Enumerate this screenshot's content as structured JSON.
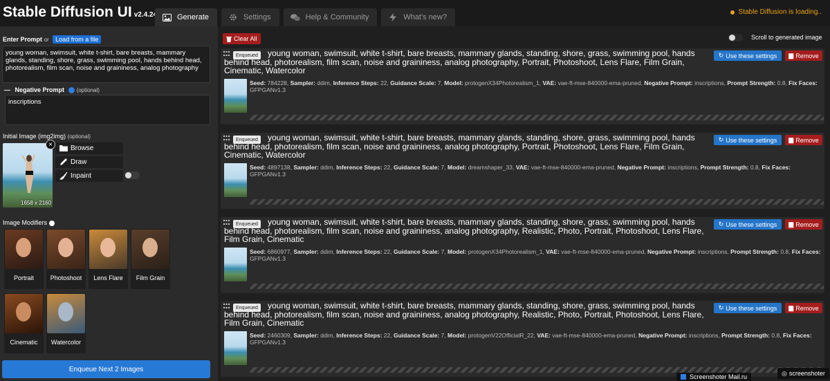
{
  "header": {
    "title": "Stable Diffusion UI",
    "version": "v2.4.24",
    "tabs": [
      {
        "label": "Generate",
        "icon": "image-icon",
        "active": true
      },
      {
        "label": "Settings",
        "icon": "gear-icon",
        "active": false
      },
      {
        "label": "Help & Community",
        "icon": "comments-icon",
        "active": false
      },
      {
        "label": "What's new?",
        "icon": "bolt-icon",
        "active": false
      }
    ],
    "status": "Stable Diffusion is loading..",
    "status_color": "#e8a317"
  },
  "left": {
    "prompt_label": "Enter Prompt",
    "or_text": "or",
    "load_button": "Load from a file",
    "prompt_value": "young woman, swimsuit, white t-shirt, bare breasts, mammary glands, standing, shore, grass, swimming pool, hands behind head, photorealism, film scan, noise and graininess, analog photography",
    "negative_toggle": "—",
    "negative_label": "Negative Prompt",
    "negative_optional": "(optional)",
    "negative_value": "inscriptions",
    "init_label": "Initial Image (img2img)",
    "init_optional": "(optional)",
    "init_dims": "1658 x 2160",
    "close_symbol": "×",
    "browse": "Browse",
    "draw": "Draw",
    "inpaint": "Inpaint",
    "modifiers_label": "Image Modifiers",
    "modifiers": [
      {
        "label": "Portrait"
      },
      {
        "label": "Photoshoot"
      },
      {
        "label": "Lens Flare"
      },
      {
        "label": "Film Grain"
      },
      {
        "label": "Cinematic"
      },
      {
        "label": "Watercolor"
      }
    ],
    "enqueue": "Enqueue Next 2 Images"
  },
  "right": {
    "clear_all": "Clear All",
    "scroll_label": "Scroll to generated image",
    "use_settings": "Use these settings",
    "remove": "Remove",
    "badge": "Enqueued",
    "tasks": [
      {
        "prompt": "young woman, swimsuit, white t-shirt, bare breasts, mammary glands, standing, shore, grass, swimming pool, hands behind head, photorealism, film scan, noise and graininess, analog photography, Portrait, Photoshoot, Lens Flare, Film Grain, Cinematic, Watercolor",
        "seed": "784228",
        "sampler": "ddim",
        "steps": "22",
        "guidance": "7",
        "model": "protogenX34Photorealism_1",
        "vae": "vae-ft-mse-840000-ema-pruned",
        "negative": "inscriptions",
        "strength": "0.8",
        "fix_faces": "GFPGANv1.3"
      },
      {
        "prompt": "young woman, swimsuit, white t-shirt, bare breasts, mammary glands, standing, shore, grass, swimming pool, hands behind head, photorealism, film scan, noise and graininess, analog photography, Portrait, Photoshoot, Lens Flare, Film Grain, Cinematic, Watercolor",
        "seed": "4897138",
        "sampler": "ddim",
        "steps": "22",
        "guidance": "7",
        "model": "dreamshaper_33",
        "vae": "vae-ft-mse-840000-ema-pruned",
        "negative": "inscriptions",
        "strength": "0.8",
        "fix_faces": "GFPGANv1.3"
      },
      {
        "prompt": "young woman, swimsuit, white t-shirt, bare breasts, mammary glands, standing, shore, grass, swimming pool, hands behind head, photorealism, film scan, noise and graininess, analog photography, Realistic, Photo, Portrait, Photoshoot, Lens Flare, Film Grain, Cinematic",
        "seed": "6860977",
        "sampler": "ddim",
        "steps": "22",
        "guidance": "7",
        "model": "protogenX34Photorealism_1",
        "vae": "vae-ft-mse-840000-ema-pruned",
        "negative": "inscriptions",
        "strength": "0.8",
        "fix_faces": "GFPGANv1.3"
      },
      {
        "prompt": "young woman, swimsuit, white t-shirt, bare breasts, mammary glands, standing, shore, grass, swimming pool, hands behind head, photorealism, film scan, noise and graininess, analog photography, Realistic, Photo, Portrait, Photoshoot, Lens Flare, Film Grain, Cinematic",
        "seed": "2460309",
        "sampler": "ddim",
        "steps": "22",
        "guidance": "7",
        "model": "protogenV22OfficialR_22",
        "vae": "vae-ft-mse-840000-ema-pruned",
        "negative": "inscriptions",
        "strength": "0.8",
        "fix_faces": "GFPGANv1.3"
      }
    ],
    "meta_labels": {
      "seed": "Seed:",
      "sampler": "Sampler:",
      "steps": "Inference Steps:",
      "guidance": "Guidance Scale:",
      "model": "Model:",
      "vae": "VAE:",
      "negative": "Negative Prompt:",
      "strength": "Prompt Strength:",
      "fix_faces": "Fix Faces:"
    }
  },
  "overlay": {
    "screenshoter_mail": "Screenshoter Mail.ru",
    "screenshoter": "screenshoter"
  }
}
